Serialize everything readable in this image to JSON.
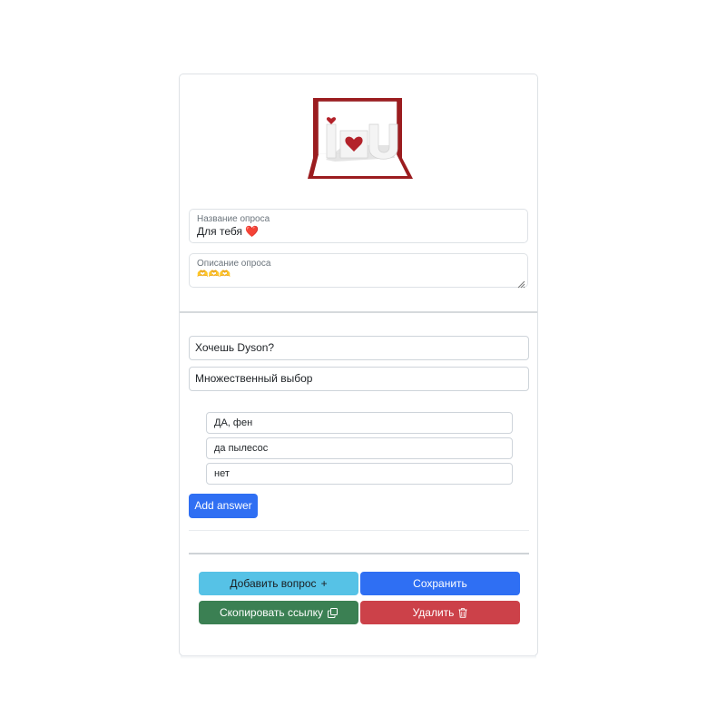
{
  "survey": {
    "title_label": "Название опроса",
    "title_value": "Для тебя ❤️",
    "description_label": "Описание опроса",
    "description_value": "🫶🫶🫶"
  },
  "cover_image": {
    "icon": "i-heart-u-popup-card",
    "card_color": "#9b1c1f"
  },
  "question": {
    "text": "Хочешь Dyson?",
    "type": "Множественный выбор",
    "answers": [
      "ДА, фен",
      "да пылесос",
      "нет"
    ],
    "add_answer_label": "Add answer"
  },
  "actions": {
    "add_question_label": "Добавить вопрос",
    "add_question_icon": "plus-icon",
    "save_label": "Сохранить",
    "copy_link_label": "Скопировать ссылку",
    "copy_link_icon": "copy-icon",
    "delete_label": "Удалить",
    "delete_icon": "trash-icon"
  },
  "colors": {
    "primary": "#2f6ff3",
    "info": "#56c2e6",
    "success": "#3b8053",
    "danger": "#cc4149"
  }
}
